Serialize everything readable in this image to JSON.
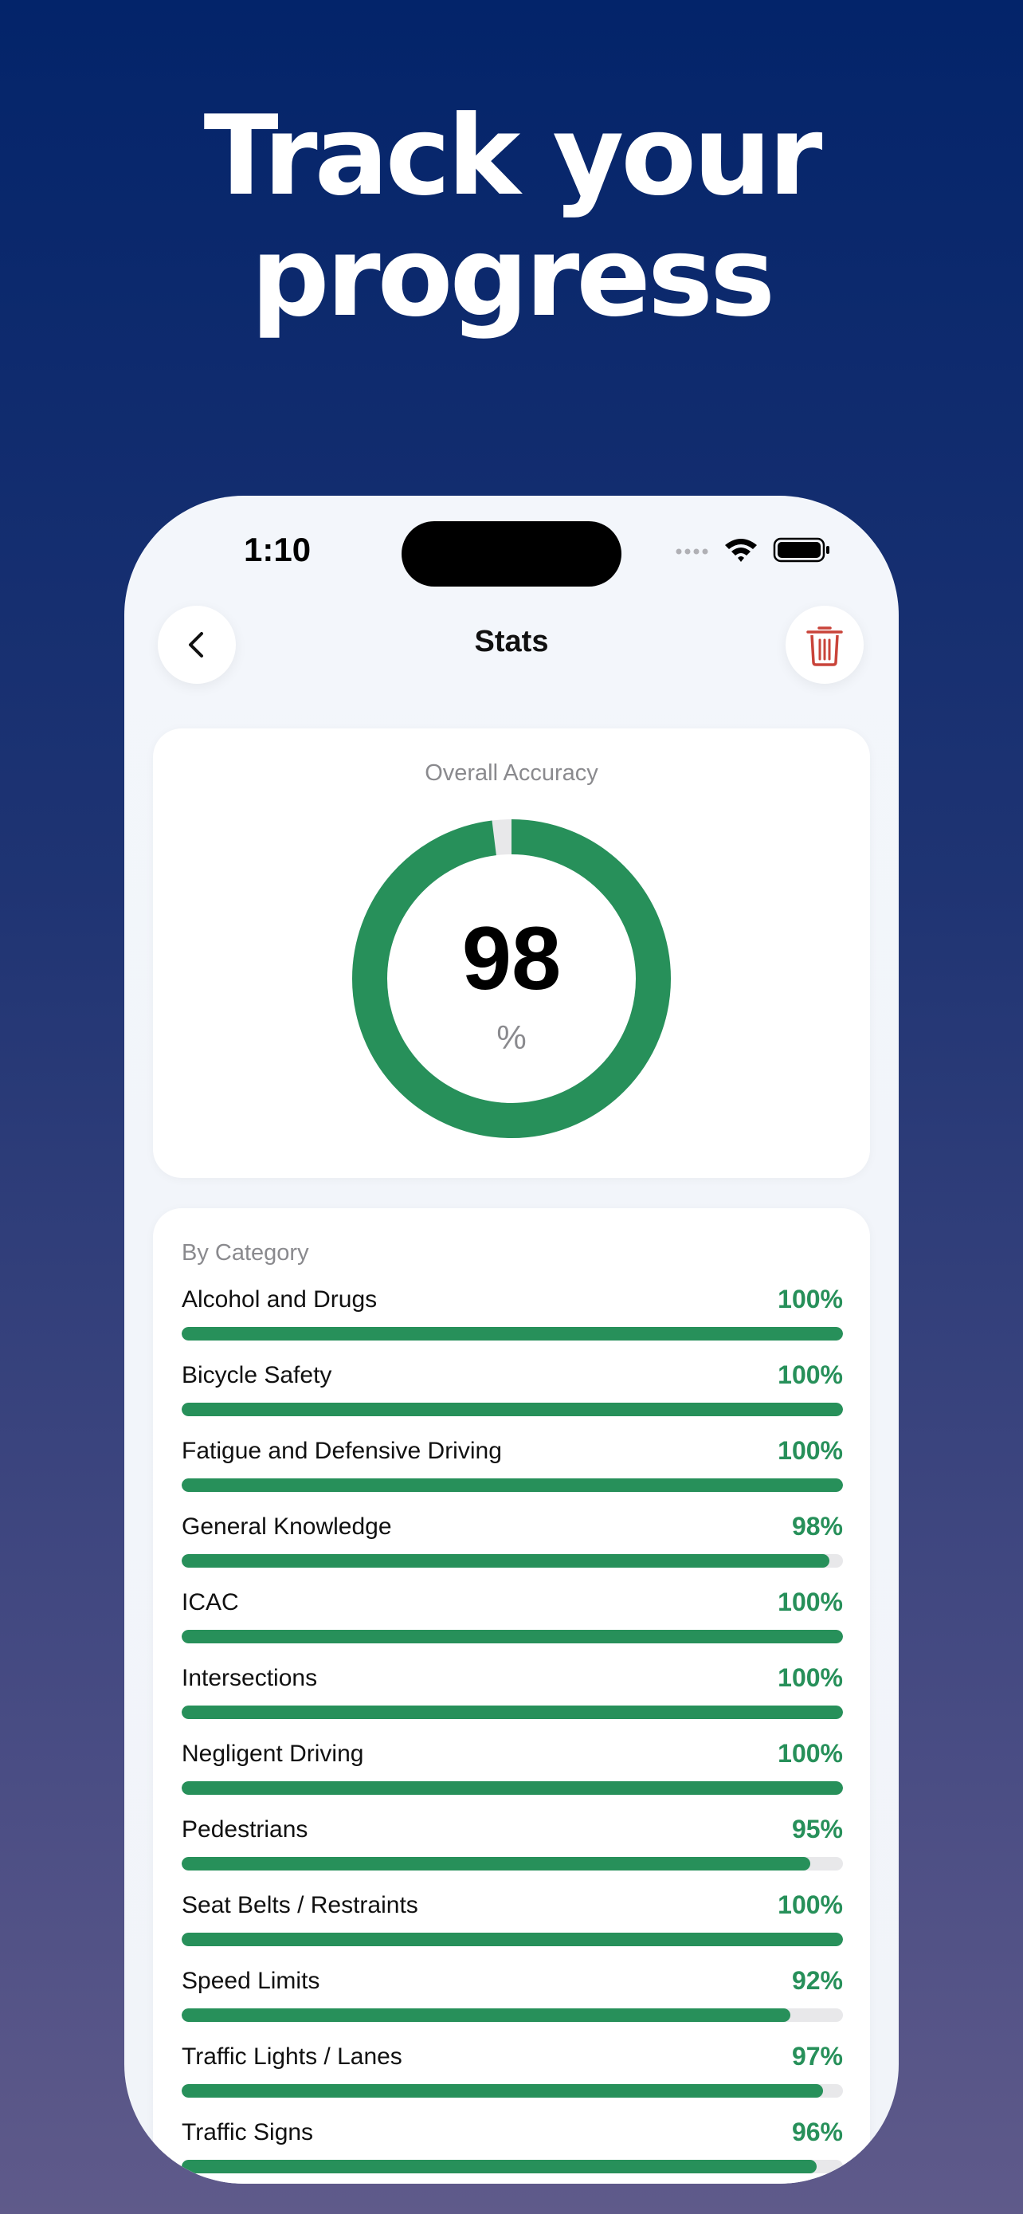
{
  "headline": {
    "line1": "Track your",
    "line2": "progress"
  },
  "status_bar": {
    "time": "1:10"
  },
  "nav": {
    "title": "Stats"
  },
  "accuracy": {
    "label": "Overall Accuracy",
    "value": "98",
    "unit": "%",
    "fraction": 0.98,
    "color": "#27905a"
  },
  "categories": {
    "label": "By Category",
    "items": [
      {
        "name": "Alcohol and Drugs",
        "pct_label": "100%",
        "fraction": 1.0
      },
      {
        "name": "Bicycle Safety",
        "pct_label": "100%",
        "fraction": 1.0
      },
      {
        "name": "Fatigue and Defensive Driving",
        "pct_label": "100%",
        "fraction": 1.0
      },
      {
        "name": "General Knowledge",
        "pct_label": "98%",
        "fraction": 0.98
      },
      {
        "name": "ICAC",
        "pct_label": "100%",
        "fraction": 1.0
      },
      {
        "name": "Intersections",
        "pct_label": "100%",
        "fraction": 1.0
      },
      {
        "name": "Negligent Driving",
        "pct_label": "100%",
        "fraction": 1.0
      },
      {
        "name": "Pedestrians",
        "pct_label": "95%",
        "fraction": 0.95
      },
      {
        "name": "Seat Belts / Restraints",
        "pct_label": "100%",
        "fraction": 1.0
      },
      {
        "name": "Speed Limits",
        "pct_label": "92%",
        "fraction": 0.92
      },
      {
        "name": "Traffic Lights / Lanes",
        "pct_label": "97%",
        "fraction": 0.97
      },
      {
        "name": "Traffic Signs",
        "pct_label": "96%",
        "fraction": 0.96
      }
    ]
  },
  "colors": {
    "accent": "#27905a",
    "trash": "#c9443a"
  },
  "icons": {
    "back": "chevron-left-icon",
    "trash": "trash-icon",
    "wifi": "wifi-icon",
    "battery": "battery-icon",
    "signal": "signal-icon"
  }
}
